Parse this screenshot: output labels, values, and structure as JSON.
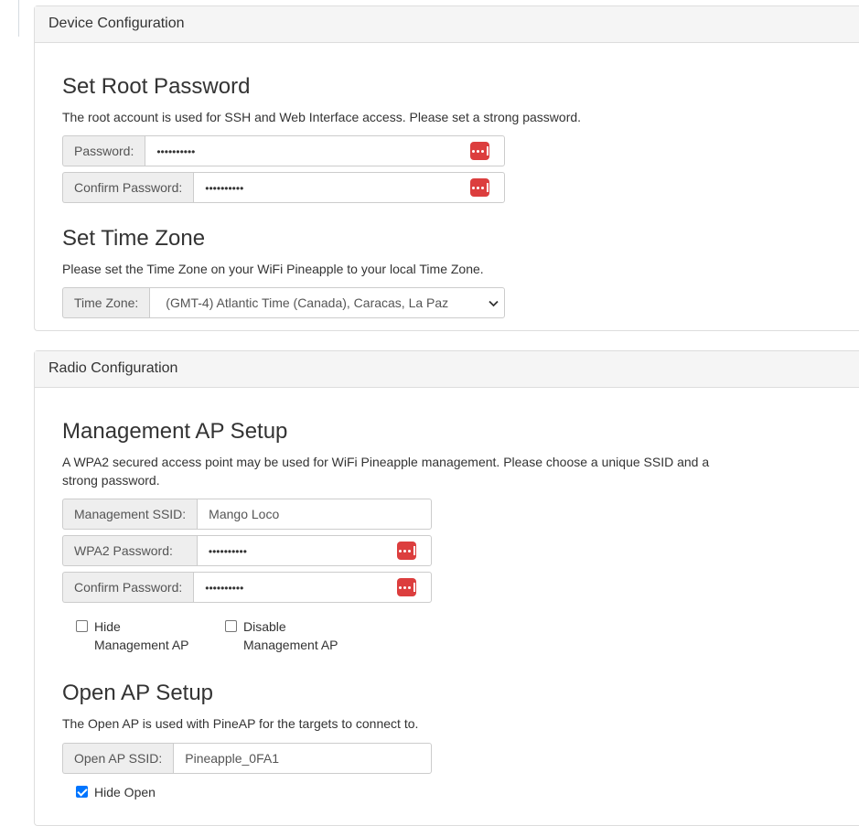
{
  "device": {
    "heading": "Device Configuration",
    "root_title": "Set Root Password",
    "root_desc": "The root account is used for SSH and Web Interface access. Please set a strong password.",
    "password_label": "Password:",
    "password_value": "••••••••••",
    "confirm_label": "Confirm Password:",
    "confirm_value": "••••••••••",
    "tz_title": "Set Time Zone",
    "tz_desc": "Please set the Time Zone on your WiFi Pineapple to your local Time Zone.",
    "tz_label": "Time Zone:",
    "tz_value": "(GMT-4) Atlantic Time (Canada), Caracas, La Paz"
  },
  "radio": {
    "heading": "Radio Configuration",
    "mgmt_title": "Management AP Setup",
    "mgmt_desc_1": "A WPA2 secured access point may be used for WiFi Pineapple management. Please choose a unique SSID and a",
    "mgmt_desc_2": "strong password.",
    "ssid_label": "Management SSID:",
    "ssid_value": "Mango Loco",
    "wpa_label": "WPA2 Password:",
    "wpa_value": "••••••••••",
    "wpa_confirm_label": "Confirm Password:",
    "wpa_confirm_value": "••••••••••",
    "hide_mgmt_1": "Hide",
    "hide_mgmt_2": "Management AP",
    "hide_mgmt_checked": false,
    "disable_mgmt_1": "Disable",
    "disable_mgmt_2": "Management AP",
    "disable_mgmt_checked": false,
    "open_title": "Open AP Setup",
    "open_desc": "The Open AP is used with PineAP for the targets to connect to.",
    "open_ssid_label": "Open AP SSID:",
    "open_ssid_value": "Pineapple_0FA1",
    "hide_open_1": "Hide Open",
    "hide_open_checked": true
  },
  "colors": {
    "password_manager_icon": "#dc3e3e",
    "checkbox_checked": "#0075ff"
  },
  "icons": [
    "password-manager-icon",
    "chevron-down-icon",
    "checkbox"
  ]
}
